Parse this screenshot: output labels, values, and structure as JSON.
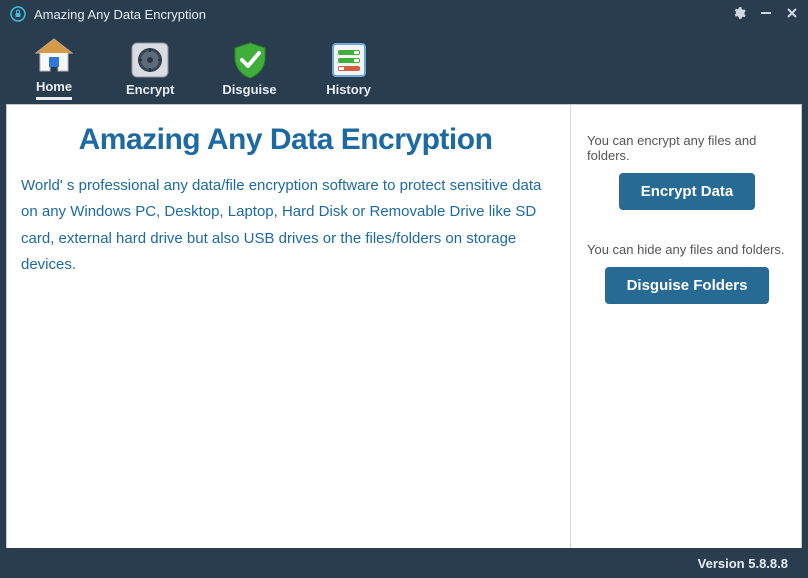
{
  "titlebar": {
    "title": "Amazing Any Data Encryption"
  },
  "toolbar": {
    "items": [
      {
        "label": "Home"
      },
      {
        "label": "Encrypt"
      },
      {
        "label": "Disguise"
      },
      {
        "label": "History"
      }
    ]
  },
  "main": {
    "heading": "Amazing Any Data Encryption",
    "description": "World' s professional any data/file encryption software to protect sensitive data on any Windows PC, Desktop, Laptop, Hard Disk or Removable Drive like SD card, external hard drive but also USB drives or the files/folders on storage devices."
  },
  "side": {
    "encrypt_hint": "You can encrypt any files and folders.",
    "encrypt_button": "Encrypt Data",
    "disguise_hint": "You can hide any files and folders.",
    "disguise_button": "Disguise Folders"
  },
  "statusbar": {
    "version_label": "Version 5.8.8.8"
  }
}
